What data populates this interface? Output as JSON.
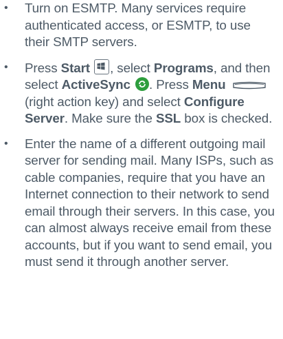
{
  "bullet_glyph": "•",
  "items": [
    {
      "text": "Turn on ESMTP. Many services require authenticated access, or ESMTP, to use their SMTP servers."
    },
    {
      "parts": {
        "t1": "Press ",
        "b1": "Start",
        "t2": ", select ",
        "b2": "Programs",
        "t3": ", and then select ",
        "b3": "ActiveSync",
        "t4": ". Press ",
        "b4": "Menu",
        "t5": " (right action key) and select ",
        "b5": "Configure Server",
        "t6": ". Make sure the ",
        "b6": "SSL",
        "t7": " box is checked."
      },
      "icons": [
        "start-icon",
        "activesync-icon",
        "right-action-key-icon"
      ]
    },
    {
      "text": "Enter the name of a different outgoing mail server for sending mail. Many ISPs, such as cable companies, require that you have an Internet connection to their network to send email through their servers. In this case, you can almost always receive email from these accounts, but if you want to send email, you must send it through another server."
    }
  ],
  "colors": {
    "text": "#4d5a66",
    "activesync_green": "#2e9e3e"
  }
}
